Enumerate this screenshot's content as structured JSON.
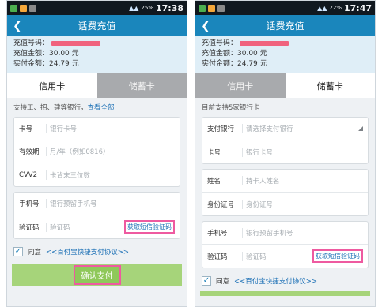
{
  "colors": {
    "title_bar": "#1a86bc",
    "status_bar": "#10181f",
    "highlight": "#ee5aa0",
    "pay_button": "#8fc85a",
    "link": "#1a6fb5"
  },
  "left": {
    "status": {
      "battery": "25%",
      "time": "17:38"
    },
    "title": "话费充值",
    "info": {
      "phone_label": "充值号码：",
      "amount_label": "充值金额：",
      "amount": "30.00 元",
      "paid_label": "实付金额：",
      "paid": "24.79 元"
    },
    "tabs": [
      "信用卡",
      "储蓄卡"
    ],
    "active_tab": 0,
    "desc": "支持工、招、建等银行，",
    "desc_link": "查看全部",
    "card_fields": [
      {
        "label": "卡号",
        "placeholder": "银行卡号"
      },
      {
        "label": "有效期",
        "placeholder": "月/年（例如0816）"
      },
      {
        "label": "CVV2",
        "placeholder": "卡背末三位数"
      }
    ],
    "verify_fields": [
      {
        "label": "手机号",
        "placeholder": "银行预留手机号"
      },
      {
        "label": "验证码",
        "placeholder": "验证码"
      }
    ],
    "sms_button": "获取短信验证码",
    "agree": "同意",
    "protocol": "<<百付宝快捷支付协议>>",
    "pay_button": "确认支付"
  },
  "right": {
    "status": {
      "battery": "22%",
      "time": "17:47"
    },
    "title": "话费充值",
    "info": {
      "phone_label": "充值号码：",
      "amount_label": "充值金额：",
      "amount": "30.00 元",
      "paid_label": "实付金额：",
      "paid": "24.79 元"
    },
    "tabs": [
      "信用卡",
      "储蓄卡"
    ],
    "active_tab": 1,
    "desc": "目前支持5家银行卡",
    "bank_fields": [
      {
        "label": "支付银行",
        "placeholder": "请选择支付银行"
      },
      {
        "label": "卡号",
        "placeholder": "银行卡号"
      }
    ],
    "id_fields": [
      {
        "label": "姓名",
        "placeholder": "持卡人姓名"
      },
      {
        "label": "身份证号",
        "placeholder": "身份证号"
      }
    ],
    "verify_fields": [
      {
        "label": "手机号",
        "placeholder": "银行预留手机号"
      },
      {
        "label": "验证码",
        "placeholder": "验证码"
      }
    ],
    "sms_button": "获取短信验证码",
    "agree": "同意",
    "protocol": "<<百付宝快捷支付协议>>"
  }
}
